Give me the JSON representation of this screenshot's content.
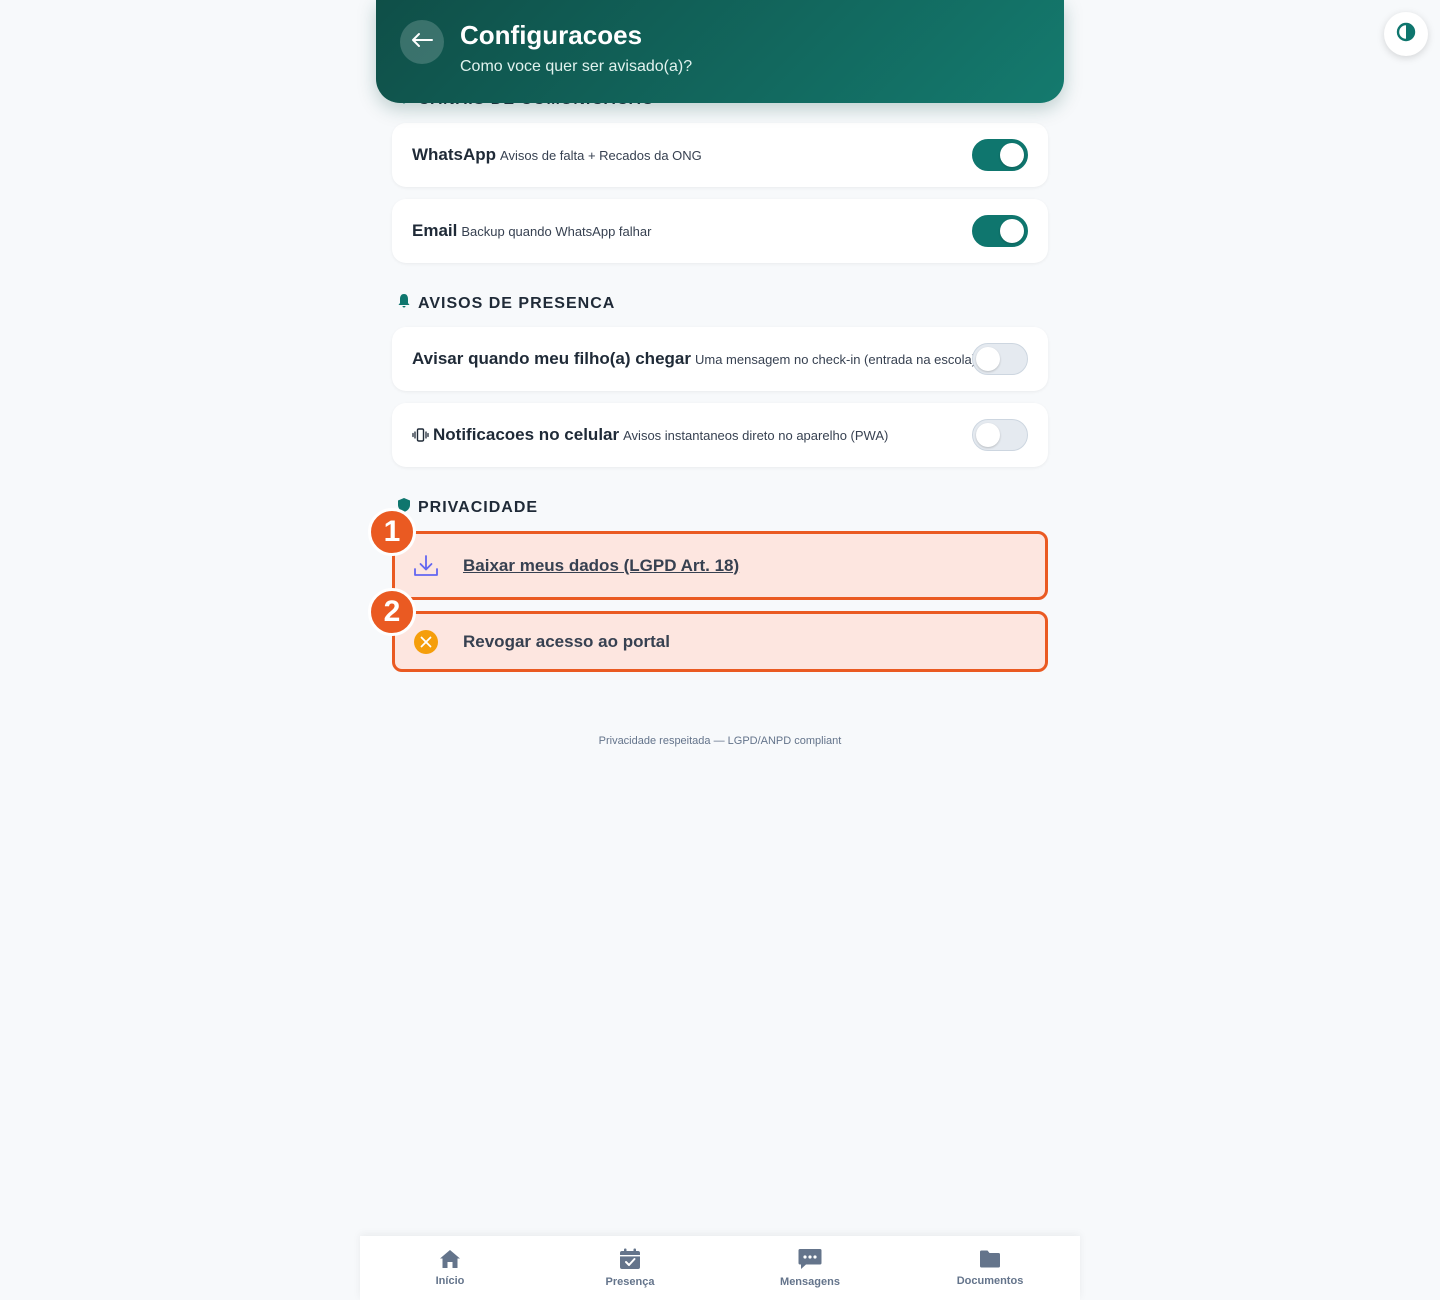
{
  "header": {
    "title": "Configuracoes",
    "subtitle": "Como voce quer ser avisado(a)?"
  },
  "sections": {
    "channels": {
      "title": "CANAIS DE COMUNICACAO",
      "items": [
        {
          "label": "WhatsApp",
          "desc": "Avisos de falta + Recados da ONG",
          "enabled": true
        },
        {
          "label": "Email",
          "desc": "Backup quando WhatsApp falhar",
          "enabled": true
        }
      ]
    },
    "presence": {
      "title": "AVISOS DE PRESENCA",
      "items": [
        {
          "label": "Avisar quando meu filho(a) chegar",
          "desc": "Uma mensagem no check-in (entrada na escola)",
          "enabled": false
        },
        {
          "label": "Notificacoes no celular",
          "desc": "Avisos instantaneos direto no aparelho (PWA)",
          "enabled": false
        }
      ]
    },
    "privacy": {
      "title": "PRIVACIDADE",
      "download_label": "Baixar meus dados (LGPD Art. 18)",
      "revoke_label": "Revogar acesso ao portal",
      "badges": [
        "1",
        "2"
      ]
    }
  },
  "footer_note": "Privacidade respeitada — LGPD/ANPD compliant",
  "nav": {
    "items": [
      {
        "label": "Início",
        "icon": "home-icon"
      },
      {
        "label": "Presença",
        "icon": "calendar-check-icon"
      },
      {
        "label": "Mensagens",
        "icon": "message-icon"
      },
      {
        "label": "Documentos",
        "icon": "folder-icon"
      }
    ]
  },
  "colors": {
    "brand": "#0f766e",
    "highlight": "#ea5a22",
    "highlight_bg": "#fde6e0",
    "revoke_icon": "#f59e0b",
    "download_icon": "#6366f1"
  }
}
